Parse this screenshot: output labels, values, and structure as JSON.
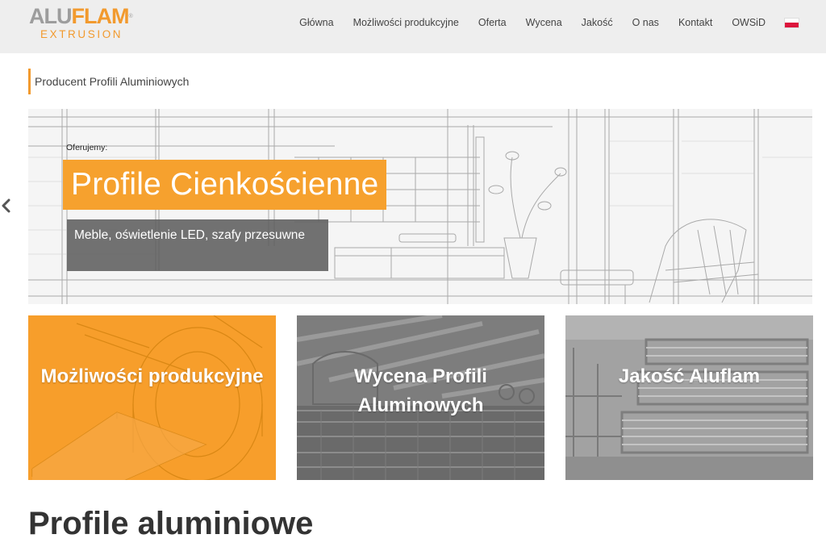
{
  "header": {
    "logo": {
      "part1": "ALU",
      "part2": "FLAM",
      "reg": "®",
      "sub": "EXTRUSION"
    },
    "nav": [
      {
        "label": "Główna"
      },
      {
        "label": "Możliwości produkcyjne"
      },
      {
        "label": "Oferta"
      },
      {
        "label": "Wycena"
      },
      {
        "label": "Jakość"
      },
      {
        "label": "O nas"
      },
      {
        "label": "Kontakt"
      },
      {
        "label": "OWSiD"
      }
    ],
    "language_flag": "pl-flag-icon"
  },
  "page": {
    "subtitle": "Producent Profili Aluminiowych"
  },
  "hero": {
    "kicker": "Oferujemy:",
    "title": "Profile Cienkościenne",
    "description": "Meble, oświetlenie LED, szafy przesuwne",
    "prev_icon": "chevron-left-icon"
  },
  "tiles": [
    {
      "label": "Możliwości produkcyjne"
    },
    {
      "label": "Wycena Profili Aluminowych"
    },
    {
      "label": "Jakość Aluflam"
    }
  ],
  "section": {
    "heading": "Profile aluminiowe"
  },
  "colors": {
    "accent": "#f29a2e",
    "header_bg": "#eeeeee",
    "text": "#333333"
  }
}
